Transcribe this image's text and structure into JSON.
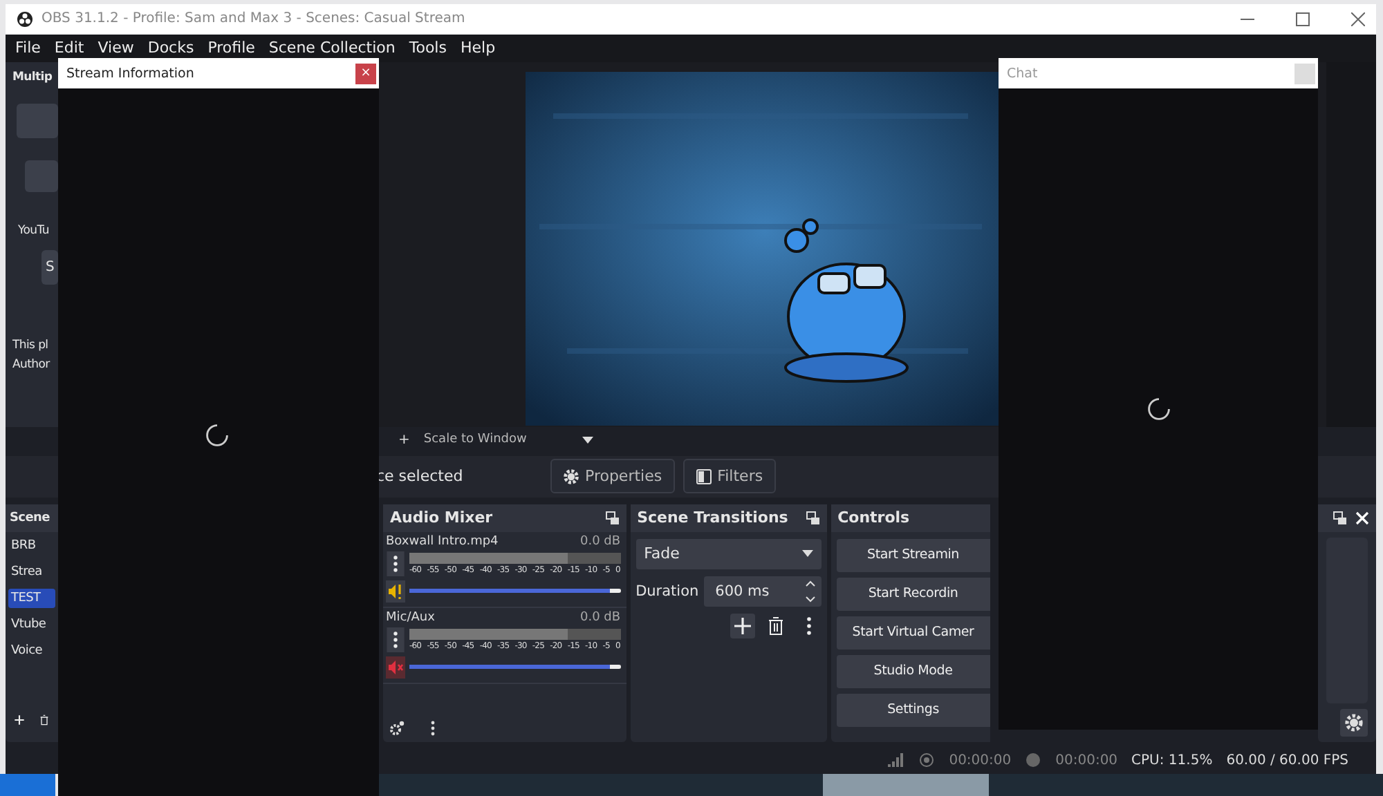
{
  "window": {
    "title": "OBS 31.1.2 - Profile: Sam and Max 3 - Scenes: Casual Stream"
  },
  "menu": [
    "File",
    "Edit",
    "View",
    "Docks",
    "Profile",
    "Scene Collection",
    "Tools",
    "Help"
  ],
  "multiview_dock": {
    "title": "Multip",
    "label": "YouTu",
    "button": "S",
    "notes": [
      "This pl",
      "Author"
    ]
  },
  "preview_toolbar": {
    "add": "+",
    "scale": "Scale to Window"
  },
  "source_bar": {
    "status": "ce selected",
    "buttons": [
      {
        "label": "Properties",
        "kind": "properties"
      },
      {
        "label": "Filters",
        "kind": "filters"
      }
    ]
  },
  "scenes": {
    "title": "Scene",
    "items": [
      {
        "label": "BRB",
        "selected": false
      },
      {
        "label": "Strea",
        "selected": false
      },
      {
        "label": "TEST",
        "selected": true
      },
      {
        "label": "Vtube",
        "selected": false
      },
      {
        "label": "Voice",
        "selected": false
      }
    ]
  },
  "audio_mixer": {
    "title": "Audio Mixer",
    "channels": [
      {
        "name": "Boxwall Intro.mp4",
        "reading": "0.0 dB",
        "kind": "warning",
        "level": 1.0,
        "scale": [
          "-60",
          "-55",
          "-50",
          "-45",
          "-40",
          "-35",
          "-30",
          "-25",
          "-20",
          "-15",
          "-10",
          "-5",
          "0"
        ]
      },
      {
        "name": "Mic/Aux",
        "reading": "0.0 dB",
        "kind": "muted",
        "level": 1.0,
        "scale": [
          "-60",
          "-55",
          "-50",
          "-45",
          "-40",
          "-35",
          "-30",
          "-25",
          "-20",
          "-15",
          "-10",
          "-5",
          "0"
        ]
      }
    ]
  },
  "scene_transitions": {
    "title": "Scene Transitions",
    "transition": "Fade",
    "duration_label": "Duration",
    "duration": "600 ms"
  },
  "controls": {
    "title": "Controls",
    "buttons": [
      "Start Streamin",
      "Start Recordin",
      "Start Virtual Camer",
      "Studio Mode",
      "Settings"
    ]
  },
  "status_bar": {
    "stream_time": "00:00:00",
    "record_time": "00:00:00",
    "cpu": "CPU: 11.5%",
    "fps": "60.00 / 60.00 FPS"
  },
  "stream_information": {
    "title": "Stream Information",
    "close": "×"
  },
  "chat": {
    "title": "Chat"
  }
}
